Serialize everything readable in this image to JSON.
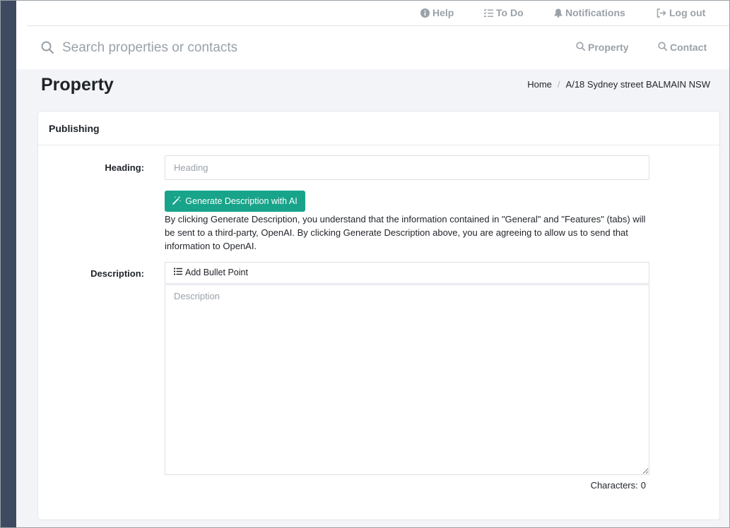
{
  "topbar": {
    "help_label": "Help",
    "todo_label": "To Do",
    "notifications_label": "Notifications",
    "logout_label": "Log out"
  },
  "search": {
    "placeholder": "Search properties or contacts"
  },
  "nav": {
    "property_label": "Property",
    "contact_label": "Contact"
  },
  "page": {
    "title": "Property",
    "breadcrumb": {
      "home": "Home",
      "separator": "/",
      "current": "A/18 Sydney street BALMAIN NSW"
    }
  },
  "card": {
    "title": "Publishing",
    "heading_label": "Heading:",
    "heading_placeholder": "Heading",
    "ai_button_label": "Generate Description with AI",
    "disclaimer": "By clicking Generate Description, you understand that the information contained in \"General\" and \"Features\" (tabs) will be sent to a third-party, OpenAI.  By clicking Generate Description above, you are agreeing to allow us to send that information to OpenAI.",
    "description_label": "Description:",
    "add_bullet_label": "Add Bullet Point",
    "description_placeholder": "Description",
    "characters_label": "Characters:",
    "characters_count": "0"
  },
  "colors": {
    "rail": "#3d4a60",
    "accent": "#17a48a",
    "muted": "#9aa1a8",
    "header_bg": "#f3f4f7"
  }
}
